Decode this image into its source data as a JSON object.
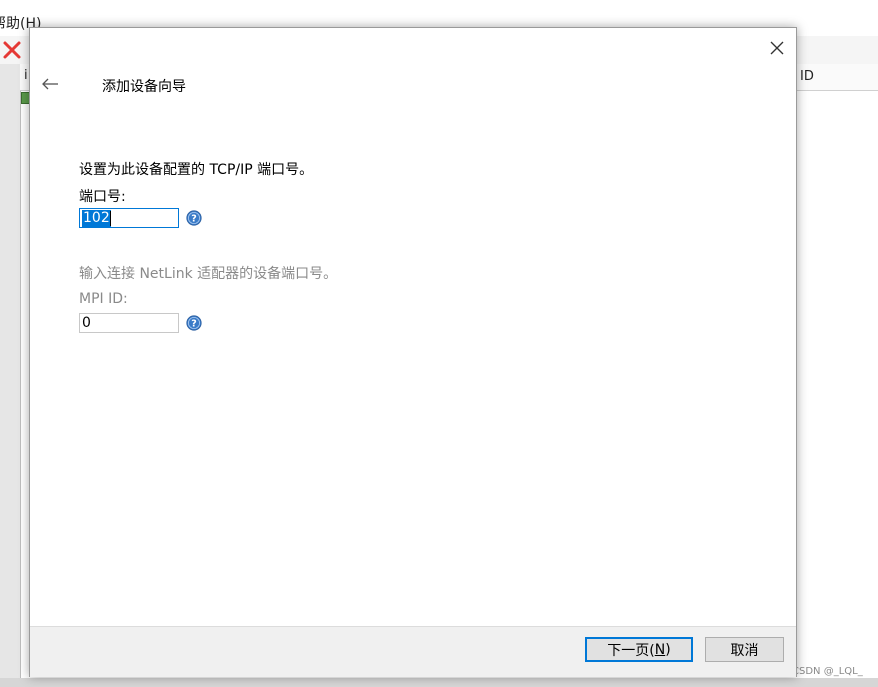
{
  "background_app": {
    "menu_help": "帮助(H)",
    "column_first": "i",
    "column_id": "ID"
  },
  "watermark": "CSDN @_LQL_",
  "dialog": {
    "title": "添加设备向导",
    "instruction": "设置为此设备配置的 TCP/IP 端口号。",
    "port": {
      "label": "端口号:",
      "value": "102"
    },
    "netlink_hint": "输入连接 NetLink 适配器的设备端口号。",
    "mpi": {
      "label": "MPI ID:",
      "value": "0"
    },
    "buttons": {
      "next_prefix": "下一页(",
      "next_mnemonic": "N",
      "next_suffix": ")",
      "cancel": "取消"
    }
  },
  "colors": {
    "accent": "#0078d7",
    "help_icon": "#3a7bc8",
    "close_icon": "#e53935",
    "disabled_text": "#8a8a8a"
  },
  "icons": [
    "close-icon",
    "back-arrow-icon",
    "help-icon",
    "delete-x-icon"
  ]
}
